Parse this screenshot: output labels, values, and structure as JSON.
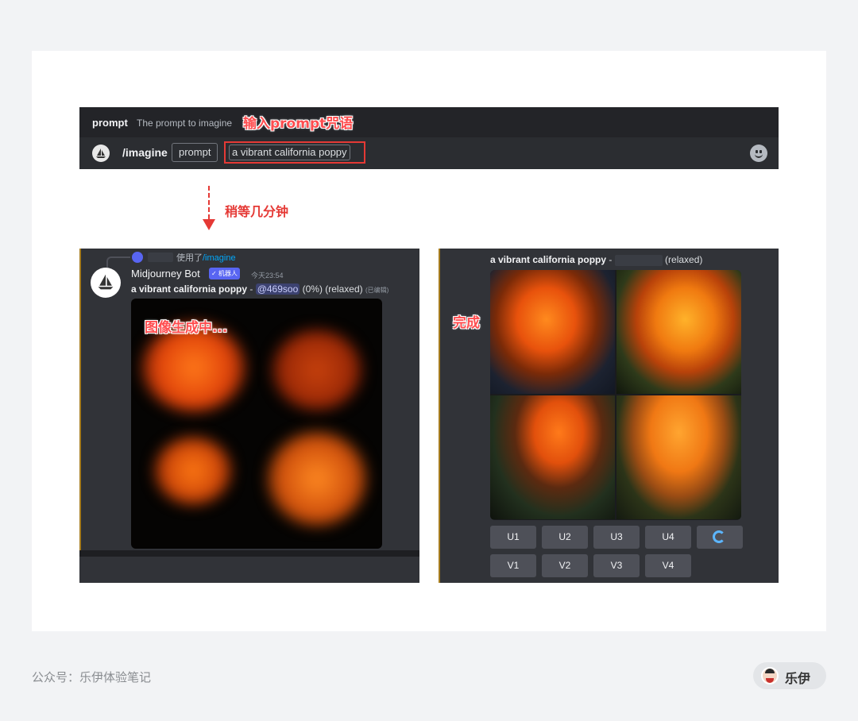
{
  "command_bar": {
    "hint_key": "prompt",
    "hint_desc": "The prompt to imagine",
    "command": "/imagine",
    "param_label": "prompt",
    "param_value": "a vibrant california poppy"
  },
  "annotations": {
    "input_note": "输入prompt咒语",
    "wait_note": "稍等几分钟",
    "generating_note": "图像生成中...",
    "done_note": "完成"
  },
  "left_message": {
    "used_prefix": "使用了",
    "used_command": "/imagine",
    "bot_name": "Midjourney Bot",
    "bot_badge": "✓ 机器人",
    "time": "今天23:54",
    "prompt": "a vibrant california poppy",
    "dash": " - ",
    "mention": "@469soo",
    "status": " (0%) (relaxed)",
    "edited": "(已编辑)"
  },
  "right_message": {
    "prompt": "a vibrant california poppy",
    "dash": " - ",
    "status": "(relaxed)",
    "upscale_buttons": [
      "U1",
      "U2",
      "U3",
      "U4"
    ],
    "variation_buttons": [
      "V1",
      "V2",
      "V3",
      "V4"
    ]
  },
  "footer": {
    "account": "公众号：乐伊体验笔记",
    "brand": "乐伊"
  }
}
